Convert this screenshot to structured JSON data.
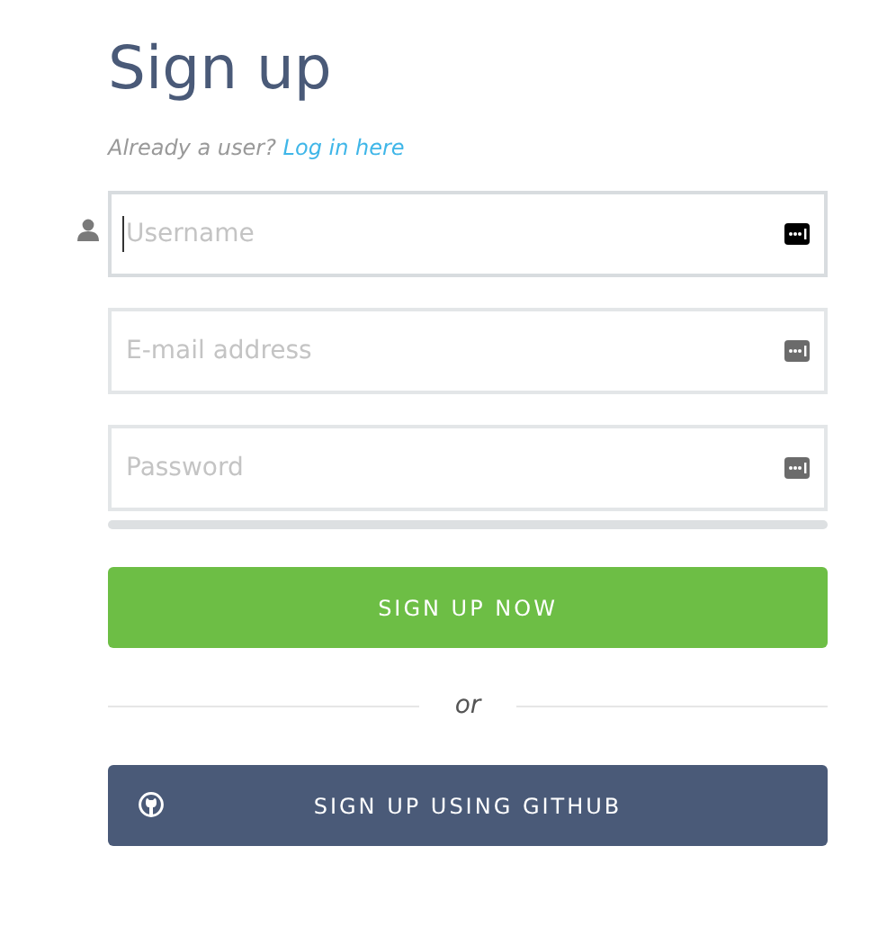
{
  "title": "Sign up",
  "subtitle": {
    "text": "Already a user?",
    "link": "Log in here"
  },
  "fields": [
    {
      "placeholder": "Username",
      "focused": true,
      "user_icon": true
    },
    {
      "placeholder": "E-mail address",
      "focused": false,
      "user_icon": false
    },
    {
      "placeholder": "Password",
      "focused": false,
      "user_icon": false
    }
  ],
  "strength_bar": {
    "level": 0
  },
  "primary_button": "SIGN UP NOW",
  "divider": "or",
  "github_button": "SIGN UP USING GITHUB"
}
